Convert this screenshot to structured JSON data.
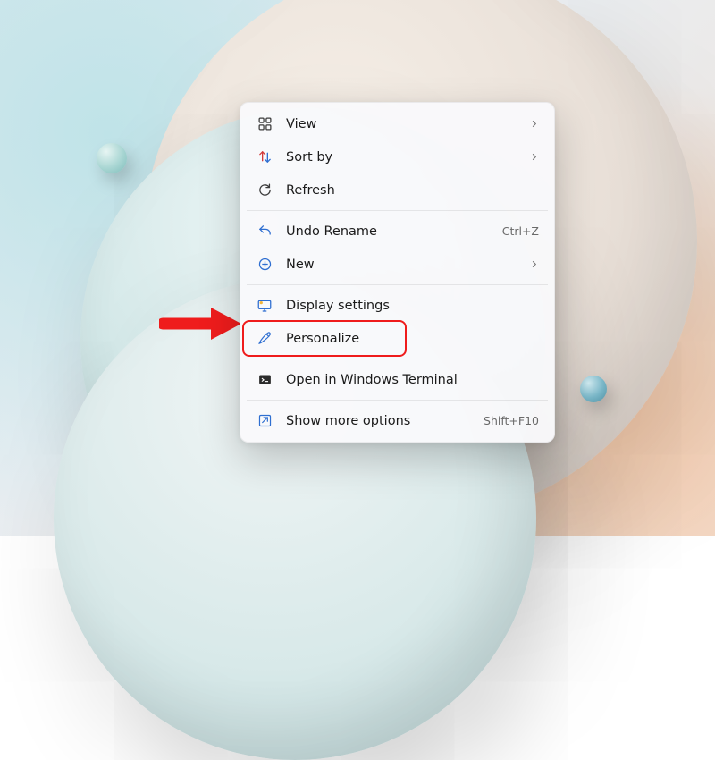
{
  "wallpaper": {
    "kind": "windows11-bloom-light",
    "orb_colors": [
      "#a9d6d3",
      "#79b6c7"
    ]
  },
  "annotation": {
    "arrow_color": "#ef1c1c",
    "highlight_target": "personalize"
  },
  "menu": {
    "groups": [
      [
        {
          "id": "view",
          "icon": "grid-icon",
          "label": "View",
          "submenu": true
        },
        {
          "id": "sortby",
          "icon": "sort-icon",
          "label": "Sort by",
          "submenu": true
        },
        {
          "id": "refresh",
          "icon": "refresh-icon",
          "label": "Refresh"
        }
      ],
      [
        {
          "id": "undo",
          "icon": "undo-icon",
          "label": "Undo Rename",
          "accel": "Ctrl+Z"
        },
        {
          "id": "new",
          "icon": "new-icon",
          "label": "New",
          "submenu": true
        }
      ],
      [
        {
          "id": "display",
          "icon": "display-settings-icon",
          "label": "Display settings"
        },
        {
          "id": "personalize",
          "icon": "personalize-icon",
          "label": "Personalize",
          "highlighted": true
        }
      ],
      [
        {
          "id": "terminal",
          "icon": "terminal-icon",
          "label": "Open in Windows Terminal"
        }
      ],
      [
        {
          "id": "more",
          "icon": "more-options-icon",
          "label": "Show more options",
          "accel": "Shift+F10"
        }
      ]
    ]
  }
}
